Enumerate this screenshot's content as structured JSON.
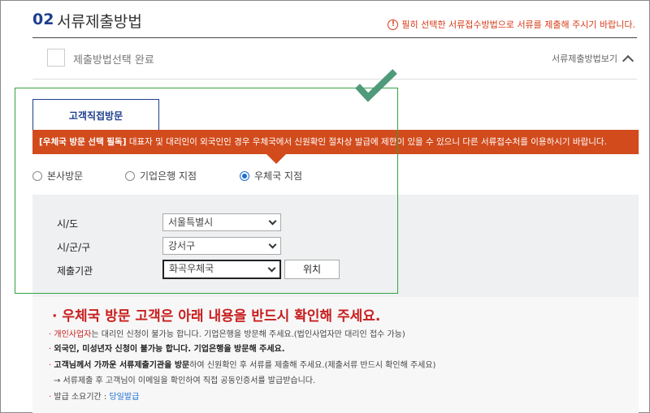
{
  "section": {
    "number": "02",
    "title": "서류제출방법"
  },
  "top_notice": {
    "icon": "info-circle-icon",
    "text": "필히 선택한 서류접수방법으로 서류를 제출해 주시기 바랍니다."
  },
  "completion": {
    "label": "제출방법선택 완료",
    "toggle_label": "서류제출방법보기"
  },
  "tabs": [
    {
      "label": "고객직접방문",
      "active": true
    }
  ],
  "warning": {
    "bold": "[우체국 방문 선택 필독]",
    "text": " 대표자 및 대리인이 외국인인 경우 우체국에서 신원확인 절차상 발급에 제한이 있을 수 있으니 다른 서류접수처를 이용하시기 바랍니다."
  },
  "visit_options": [
    {
      "label": "본사방문",
      "selected": false
    },
    {
      "label": "기업은행 지점",
      "selected": false
    },
    {
      "label": "우체국 지점",
      "selected": true
    }
  ],
  "form": {
    "fields": [
      {
        "label": "시/도",
        "value": "서울특별시"
      },
      {
        "label": "시/군/구",
        "value": "강서구"
      },
      {
        "label": "제출기관",
        "value": "화곡우체국"
      }
    ],
    "location_button": "위치"
  },
  "info": {
    "title": "우체국 방문 고객은 아래 내용을 반드시 확인해 주세요.",
    "line1": {
      "red": "개인사업자",
      "rest": "는 대리인 신청이 불가능 합니다. 기업은행을 방문해 주세요.(법인사업자만 대리인 접수 가능)"
    },
    "line2": "외국인, 미성년자 신청이 불가능 합니다. 기업은행을 방문해 주세요.",
    "line3": {
      "bold": "고객님께서 가까운 서류제출기관을 방문",
      "rest": "하여 신원확인 후 서류를 제출해 주세요.(제출서류 반드시 확인해 주세요)"
    },
    "line4": "→ 서류제출 후 고객님이 이메일을 확인하여 직접 공동인증서를 발급받습니다.",
    "line5": {
      "label": "발급 소요기간 : ",
      "value": "당일발급"
    }
  },
  "colors": {
    "accent": "#1d3f8c",
    "warning": "#d24b1c",
    "alert_red": "#c81e1e",
    "highlight_green": "#33a343",
    "check_green": "#4e9a7a"
  }
}
